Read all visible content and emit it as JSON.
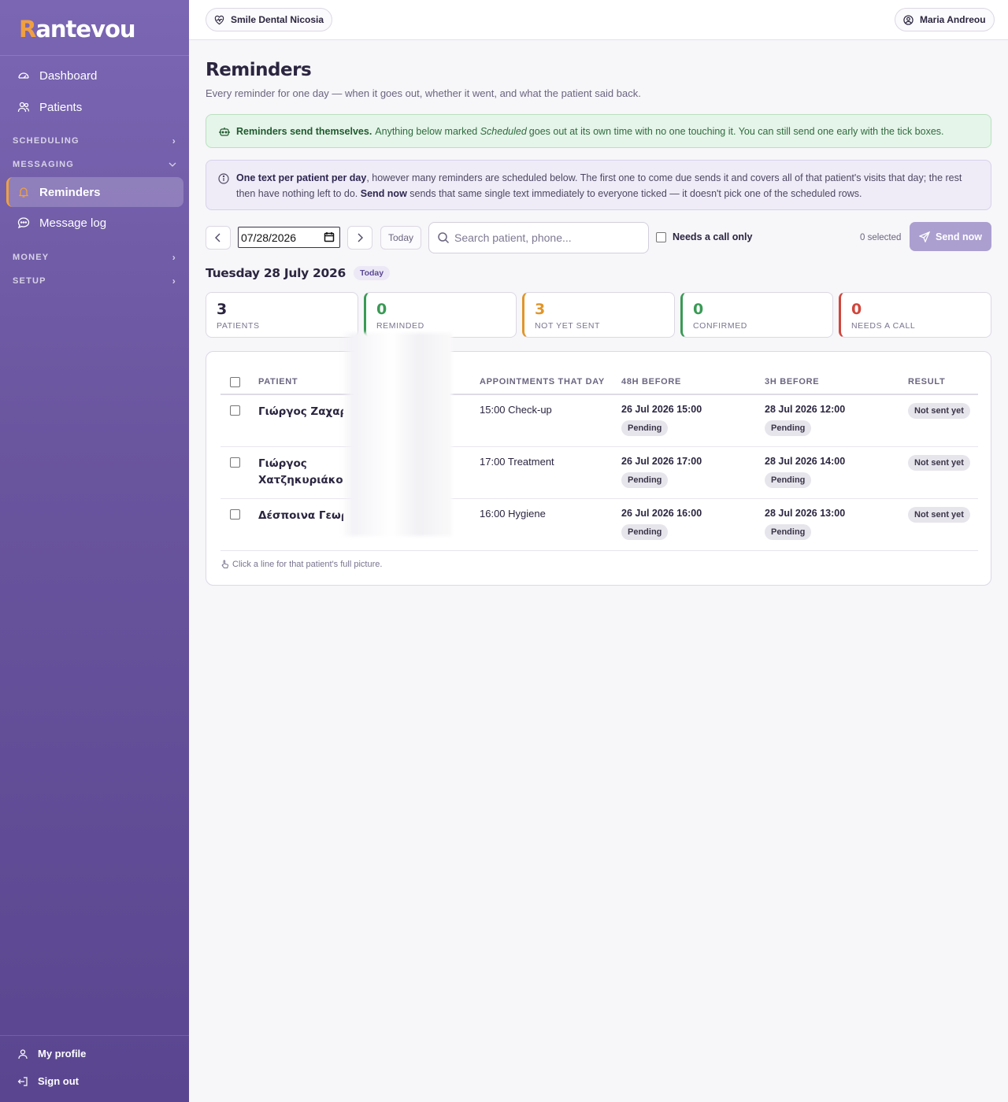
{
  "brand": {
    "logo_first": "R",
    "logo_rest": "antevou"
  },
  "sidebar": {
    "items": [
      {
        "label": "Dashboard",
        "icon": "gauge-icon"
      },
      {
        "label": "Patients",
        "icon": "users-icon"
      },
      {
        "label": "Reminders",
        "icon": "bell-icon",
        "active": true
      },
      {
        "label": "Message log",
        "icon": "chat-icon"
      }
    ],
    "sections": {
      "scheduling": "SCHEDULING",
      "messaging": "MESSAGING",
      "money": "MONEY",
      "setup": "SETUP"
    },
    "bottom": {
      "profile": "My profile",
      "signout": "Sign out"
    }
  },
  "topbar": {
    "clinic": "Smile Dental Nicosia",
    "user": "Maria Andreou"
  },
  "page": {
    "title": "Reminders",
    "subtitle": "Every reminder for one day — when it goes out, whether it went, and what the patient said back."
  },
  "banner_green": {
    "bold": "Reminders send themselves.",
    "text_a": "Anything below marked",
    "italic": "Scheduled",
    "text_b": "goes out at its own time with no one touching it. You can still send one early with the tick boxes."
  },
  "banner_purple": {
    "bold1": "One text per patient per day",
    "text1": ", however many reminders are scheduled below. The first one to come due sends it and covers all of that patient's visits that day; the rest then have nothing left to do. ",
    "bold2": "Send now",
    "text2": " sends that same single text immediately to everyone ticked — it doesn't pick one of the scheduled rows."
  },
  "toolbar": {
    "date_value": "07/28/2026",
    "today_label": "Today",
    "search_placeholder": "Search patient, phone...",
    "needs_call_label": "Needs a call only",
    "selected_text": "0 selected",
    "send_label": "Send now"
  },
  "day": {
    "title": "Tuesday 28 July 2026",
    "tag": "Today"
  },
  "stats": [
    {
      "value": "3",
      "label": "PATIENTS",
      "color": "#2b2540"
    },
    {
      "value": "0",
      "label": "REMINDED",
      "color": "#3a9a55"
    },
    {
      "value": "3",
      "label": "NOT YET SENT",
      "color": "#e0962a"
    },
    {
      "value": "0",
      "label": "CONFIRMED",
      "color": "#3a9a55"
    },
    {
      "value": "0",
      "label": "NEEDS A CALL",
      "color": "#d0463c"
    }
  ],
  "table": {
    "headers": {
      "patient": "PATIENT",
      "appts": "APPOINTMENTS THAT DAY",
      "h48": "48H BEFORE",
      "h3": "3H BEFORE",
      "result": "RESULT"
    },
    "rows": [
      {
        "name": "Γιώργος Ζαχαρ",
        "appt": "15:00 Check-up",
        "h48_time": "26 Jul 2026 15:00",
        "h48_status": "Pending",
        "h3_time": "28 Jul 2026 12:00",
        "h3_status": "Pending",
        "result": "Not sent yet"
      },
      {
        "name": "Γιώργος Χατζηκυριάκο",
        "appt": "17:00 Treatment",
        "h48_time": "26 Jul 2026 17:00",
        "h48_status": "Pending",
        "h3_time": "28 Jul 2026 14:00",
        "h3_status": "Pending",
        "result": "Not sent yet"
      },
      {
        "name": "Δέσποινα Γεωρ",
        "appt": "16:00 Hygiene",
        "h48_time": "26 Jul 2026 16:00",
        "h48_status": "Pending",
        "h3_time": "28 Jul 2026 13:00",
        "h3_status": "Pending",
        "result": "Not sent yet"
      }
    ],
    "hint": "Click a line for that patient's full picture."
  }
}
